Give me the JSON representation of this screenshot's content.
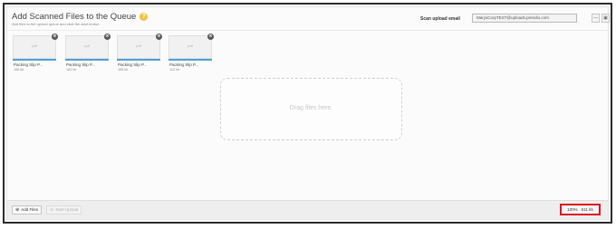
{
  "header": {
    "title": "Add Scanned Files to the Queue",
    "subtitle": "Add files to the upload queue and click the start button.",
    "help_icon": "?",
    "scan_label": "Scan upload email",
    "scan_email": "MarysCorpTEST@uploads.prendio.com",
    "btn1": "—",
    "btn2": "▣"
  },
  "files": [
    {
      "ext": "pdf",
      "name": "Packing Slip P...",
      "size": "166 kb",
      "progress": 1.0
    },
    {
      "ext": "pdf",
      "name": "Packing Slip P...",
      "size": "164 kb",
      "progress": 1.0
    },
    {
      "ext": "pdf",
      "name": "Packing Slip P...",
      "size": "168 kb",
      "progress": 1.0
    },
    {
      "ext": "pdf",
      "name": "Packing Slip P...",
      "size": "112 kb",
      "progress": 1.0
    }
  ],
  "remove_glyph": "⊗",
  "dropzone": {
    "text": "Drag files here."
  },
  "footer": {
    "add_label": "Add Files",
    "add_icon": "⊕",
    "start_label": "Start Upload",
    "start_icon": "⊙",
    "percent": "100%",
    "total": "611 kb"
  }
}
